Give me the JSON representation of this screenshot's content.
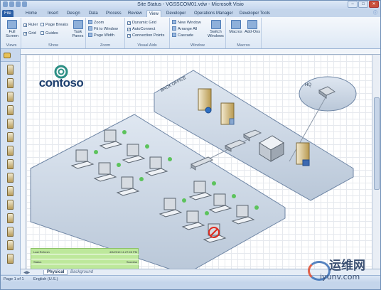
{
  "window": {
    "title": "Site Status - VGSSCOM01.vdw - Microsoft Visio",
    "controls": [
      "–",
      "□",
      "✕"
    ]
  },
  "tabs": [
    {
      "label": "File"
    },
    {
      "label": "Home"
    },
    {
      "label": "Insert"
    },
    {
      "label": "Design"
    },
    {
      "label": "Data"
    },
    {
      "label": "Process"
    },
    {
      "label": "Review"
    },
    {
      "label": "View"
    },
    {
      "label": "Developer"
    },
    {
      "label": "Operations Manager"
    },
    {
      "label": "Developer Tools"
    }
  ],
  "ribbon": {
    "views": {
      "full_screen": "Full\nScreen",
      "group": "Views"
    },
    "show": {
      "ruler": "Ruler",
      "grid": "Grid",
      "page_breaks": "Page Breaks",
      "guides": "Guides",
      "task_panes": "Task\nPanes",
      "group": "Show"
    },
    "zoom": {
      "zoom": "Zoom",
      "fit": "Fit to Window",
      "page_width": "Page Width",
      "group": "Zoom"
    },
    "visual_aids": {
      "dynamic_grid": "Dynamic Grid",
      "autoconnect": "AutoConnect",
      "connection_points": "Connection Points",
      "group": "Visual Aids"
    },
    "window": {
      "new_window": "New Window",
      "arrange_all": "Arrange All",
      "cascade": "Cascade",
      "switch_windows": "Switch\nWindows",
      "group": "Window"
    },
    "macros": {
      "macros": "Macros",
      "addons": "Add-Ons",
      "group": "Macros"
    }
  },
  "diagram": {
    "logo": "contoso",
    "back_office": "BACK OFFICE",
    "hq": "HQ"
  },
  "status_box": {
    "rows": [
      {
        "label": "Last Refresh",
        "value": "4/5/2010 11:27:28 PM"
      },
      {
        "label": "",
        "value": ""
      },
      {
        "label": "Status",
        "value": "Success"
      },
      {
        "label": "",
        "value": ""
      }
    ]
  },
  "page_tabs": {
    "active": "Physical",
    "other": "Background"
  },
  "statusbar": {
    "page": "Page 1 of 1",
    "language": "English (U.S.)"
  },
  "watermark": {
    "cn": "运维网",
    "url": "iyunv.com"
  }
}
